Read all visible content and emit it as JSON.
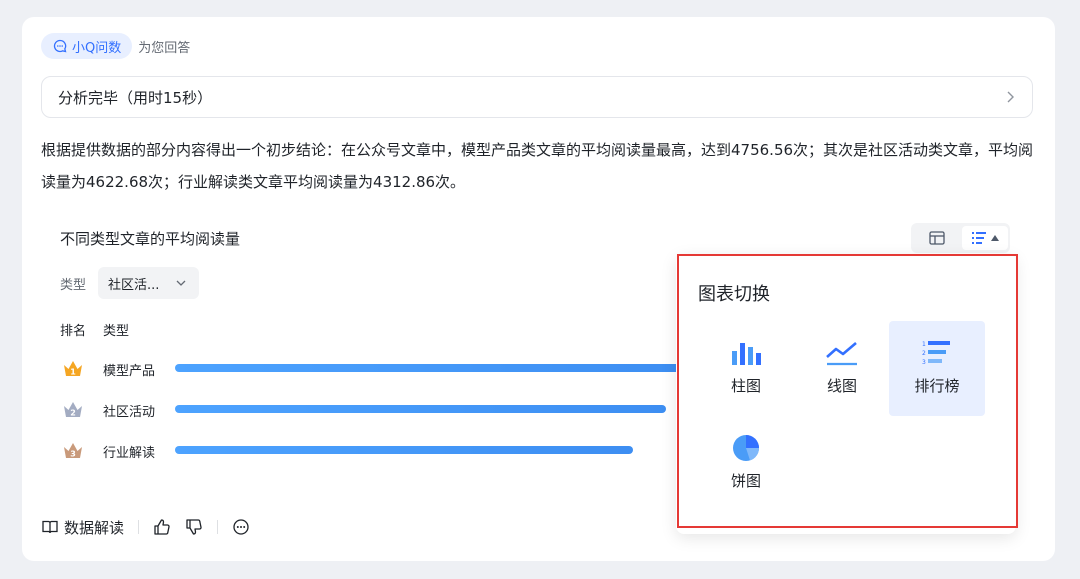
{
  "assistant": {
    "badge_label": "小Q问数",
    "subtitle": "为您回答"
  },
  "analysis": {
    "status_label": "分析完毕（用时15秒）"
  },
  "conclusion": {
    "text": "根据提供数据的部分内容得出一个初步结论：在公众号文章中，模型产品类文章的平均阅读量最高，达到4756.56次；其次是社区活动类文章，平均阅读量为4622.68次；行业解读类文章平均阅读量为4312.86次。"
  },
  "chart": {
    "title": "不同类型文章的平均阅读量",
    "filter": {
      "label": "类型",
      "value": "社区活..."
    },
    "columns": {
      "rank": "排名",
      "type": "类型"
    }
  },
  "chart_data": {
    "type": "bar",
    "orientation": "horizontal-ranking",
    "title": "不同类型文章的平均阅读量",
    "categories": [
      "模型产品",
      "社区活动",
      "行业解读"
    ],
    "values": [
      4756.56,
      4622.68,
      4312.86
    ],
    "ranks": [
      1,
      2,
      3
    ]
  },
  "rank_colors": [
    "#f5a623",
    "#a3acc2",
    "#c99a7b"
  ],
  "footer": {
    "interpret_label": "数据解读"
  },
  "popover": {
    "title": "图表切换",
    "options": [
      {
        "label": "柱图",
        "icon": "bar-chart-icon"
      },
      {
        "label": "线图",
        "icon": "line-chart-icon"
      },
      {
        "label": "排行榜",
        "icon": "ranking-icon",
        "selected": true
      },
      {
        "label": "饼图",
        "icon": "pie-chart-icon"
      }
    ]
  },
  "colors": {
    "accent": "#3370ff",
    "highlight_border": "#e53935",
    "bar": "#4a9cf7"
  }
}
